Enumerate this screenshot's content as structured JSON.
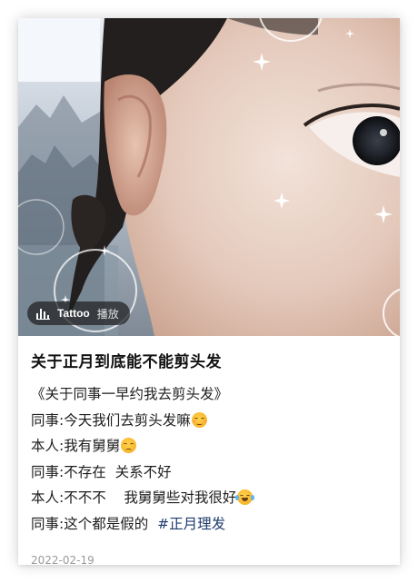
{
  "post": {
    "music": {
      "song": "Tattoo",
      "play_label": "播放",
      "icon": "sound-bars-icon"
    },
    "title": "关于正月到底能不能剪头发",
    "lines": [
      {
        "text": "《关于同事一早约我去剪头发》",
        "emoji": null
      },
      {
        "text": "同事:今天我们去剪头发嘛",
        "emoji": "relieved-face-emoji"
      },
      {
        "text": "本人:我有舅舅",
        "emoji": "unamused-face-emoji"
      },
      {
        "text": "同事:不存在  关系不好",
        "emoji": null
      },
      {
        "text": "本人:不不不    我舅舅些对我很好",
        "emoji": "tears-of-joy-emoji"
      },
      {
        "text": "同事:这个都是假的  ",
        "emoji": null,
        "hashtag": "#正月理发"
      }
    ],
    "date": "2022-02-19",
    "colors": {
      "hashtag": "#1e3a6e",
      "text": "#1d1d1d",
      "date": "#9a9a9a"
    }
  }
}
